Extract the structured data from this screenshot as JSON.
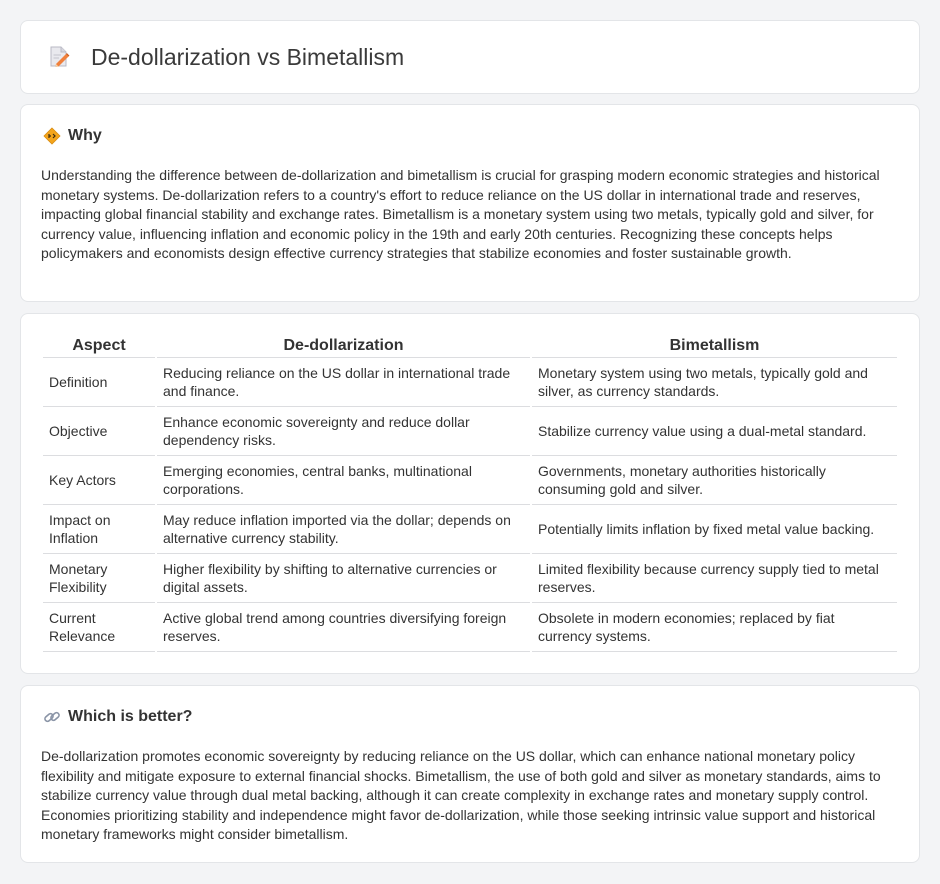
{
  "header": {
    "title": "De-dollarization vs Bimetallism",
    "icon": "document-pencil-icon"
  },
  "why": {
    "heading": "Why",
    "icon": "diamond-sign-icon",
    "text": "Understanding the difference between de-dollarization and bimetallism is crucial for grasping modern economic strategies and historical monetary systems. De-dollarization refers to a country's effort to reduce reliance on the US dollar in international trade and reserves, impacting global financial stability and exchange rates. Bimetallism is a monetary system using two metals, typically gold and silver, for currency value, influencing inflation and economic policy in the 19th and early 20th centuries. Recognizing these concepts helps policymakers and economists design effective currency strategies that stabilize economies and foster sustainable growth."
  },
  "table": {
    "headers": [
      "Aspect",
      "De-dollarization",
      "Bimetallism"
    ],
    "rows": [
      [
        "Definition",
        "Reducing reliance on the US dollar in international trade and finance.",
        "Monetary system using two metals, typically gold and silver, as currency standards."
      ],
      [
        "Objective",
        "Enhance economic sovereignty and reduce dollar dependency risks.",
        "Stabilize currency value using a dual-metal standard."
      ],
      [
        "Key Actors",
        "Emerging economies, central banks, multinational corporations.",
        "Governments, monetary authorities historically consuming gold and silver."
      ],
      [
        "Impact on Inflation",
        "May reduce inflation imported via the dollar; depends on alternative currency stability.",
        "Potentially limits inflation by fixed metal value backing."
      ],
      [
        "Monetary Flexibility",
        "Higher flexibility by shifting to alternative currencies or digital assets.",
        "Limited flexibility because currency supply tied to metal reserves."
      ],
      [
        "Current Relevance",
        "Active global trend among countries diversifying foreign reserves.",
        "Obsolete in modern economies; replaced by fiat currency systems."
      ]
    ]
  },
  "better": {
    "heading": "Which is better?",
    "icon": "link-icon",
    "text": "De-dollarization promotes economic sovereignty by reducing reliance on the US dollar, which can enhance national monetary policy flexibility and mitigate exposure to external financial shocks. Bimetallism, the use of both gold and silver as monetary standards, aims to stabilize currency value through dual metal backing, although it can create complexity in exchange rates and monetary supply control. Economies prioritizing stability and independence might favor de-dollarization, while those seeking intrinsic value support and historical monetary frameworks might consider bimetallism."
  }
}
